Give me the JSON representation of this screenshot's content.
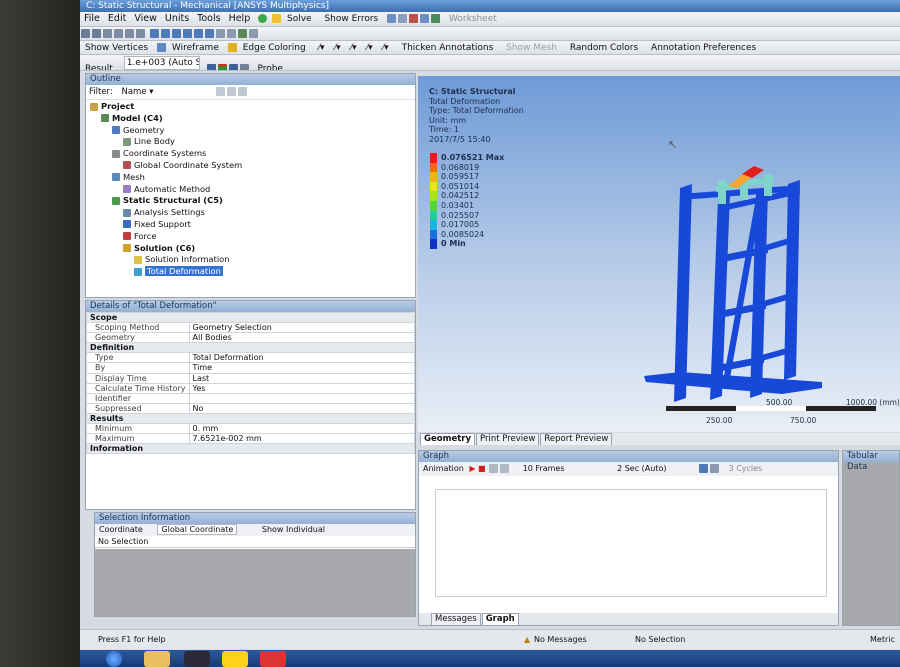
{
  "window": {
    "title": "C: Static Structural - Mechanical [ANSYS Multiphysics]"
  },
  "menu": [
    "File",
    "Edit",
    "View",
    "Units",
    "Tools",
    "Help"
  ],
  "toolbar": {
    "solve": "Solve",
    "show_errors": "Show Errors",
    "worksheet": "Worksheet",
    "show_vertices": "Show Vertices",
    "wireframe": "Wireframe",
    "edge_coloring": "Edge Coloring",
    "thicken_annotations": "Thicken Annotations",
    "show_mesh": "Show Mesh",
    "random_colors": "Random Colors",
    "annotation_preferences": "Annotation Preferences",
    "result_label": "Result",
    "result_scale": "1.e+003 (Auto Sc",
    "probe": "Probe"
  },
  "outline": {
    "title": "Outline",
    "filter_label": "Filter:",
    "filter_value": "Name",
    "items": [
      {
        "label": "Project",
        "depth": 0,
        "bold": true,
        "icon": "project-icon"
      },
      {
        "label": "Model (C4)",
        "depth": 1,
        "bold": true,
        "icon": "model-icon"
      },
      {
        "label": "Geometry",
        "depth": 2,
        "bold": false,
        "icon": "geometry-icon"
      },
      {
        "label": "Line Body",
        "depth": 3,
        "bold": false,
        "icon": "line-body-icon"
      },
      {
        "label": "Coordinate Systems",
        "depth": 2,
        "bold": false,
        "icon": "coordinate-systems-icon"
      },
      {
        "label": "Global Coordinate System",
        "depth": 3,
        "bold": false,
        "icon": "axis-icon"
      },
      {
        "label": "Mesh",
        "depth": 2,
        "bold": false,
        "icon": "mesh-icon"
      },
      {
        "label": "Automatic Method",
        "depth": 3,
        "bold": false,
        "icon": "method-icon"
      },
      {
        "label": "Static Structural (C5)",
        "depth": 2,
        "bold": true,
        "icon": "analysis-icon"
      },
      {
        "label": "Analysis Settings",
        "depth": 3,
        "bold": false,
        "icon": "settings-icon"
      },
      {
        "label": "Fixed Support",
        "depth": 3,
        "bold": false,
        "icon": "fixed-support-icon"
      },
      {
        "label": "Force",
        "depth": 3,
        "bold": false,
        "icon": "force-icon"
      },
      {
        "label": "Solution (C6)",
        "depth": 3,
        "bold": true,
        "icon": "solution-icon"
      },
      {
        "label": "Solution Information",
        "depth": 4,
        "bold": false,
        "icon": "info-icon"
      },
      {
        "label": "Total Deformation",
        "depth": 4,
        "bold": false,
        "selected": true,
        "icon": "deformation-icon"
      }
    ]
  },
  "details": {
    "title": "Details of \"Total Deformation\"",
    "groups": [
      {
        "name": "Scope",
        "rows": [
          [
            "Scoping Method",
            "Geometry Selection"
          ],
          [
            "Geometry",
            "All Bodies"
          ]
        ]
      },
      {
        "name": "Definition",
        "rows": [
          [
            "Type",
            "Total Deformation"
          ],
          [
            "By",
            "Time"
          ],
          [
            "Display Time",
            "Last"
          ],
          [
            "Calculate Time History",
            "Yes"
          ],
          [
            "Identifier",
            ""
          ],
          [
            "Suppressed",
            "No"
          ]
        ]
      },
      {
        "name": "Results",
        "rows": [
          [
            "Minimum",
            "0. mm"
          ],
          [
            "Maximum",
            "7.6521e-002 mm"
          ]
        ]
      },
      {
        "name": "Information",
        "rows": []
      }
    ]
  },
  "selection": {
    "title": "Selection Information",
    "coordinate_label": "Coordinate",
    "coordinate_value": "Global Coordinate",
    "show_individual": "Show Individual",
    "no_selection": "No Selection"
  },
  "viewport": {
    "header": [
      "C: Static Structural",
      "Total Deformation",
      "Type: Total Deformation",
      "Unit: mm",
      "Time: 1",
      "2017/7/5 15:40"
    ],
    "legend": [
      {
        "label": "0.076521 Max",
        "color": "#e0211b"
      },
      {
        "label": "0.068019",
        "color": "#f06a1c"
      },
      {
        "label": "0.059517",
        "color": "#f4b21f"
      },
      {
        "label": "0.051014",
        "color": "#e6e321"
      },
      {
        "label": "0.042512",
        "color": "#a6e02a"
      },
      {
        "label": "0.03401",
        "color": "#52d63a"
      },
      {
        "label": "0.025507",
        "color": "#1fcf9a"
      },
      {
        "label": "0.017005",
        "color": "#1ab5de"
      },
      {
        "label": "0.0085024",
        "color": "#1a6fe0"
      },
      {
        "label": "0 Min",
        "color": "#1030c8"
      }
    ],
    "scale_top": [
      "500.00",
      "1000.00 (mm)"
    ],
    "scale_bottom": [
      "250.00",
      "750.00"
    ],
    "tabs": [
      "Geometry",
      "Print Preview",
      "Report Preview"
    ],
    "structure_color": "#1848d8",
    "top_color": "#7fd4c9"
  },
  "graph": {
    "title": "Graph",
    "animation_label": "Animation",
    "frames": "10 Frames",
    "duration": "2 Sec (Auto)",
    "cycles": "3 Cycles",
    "tabs": [
      "Messages",
      "Graph"
    ]
  },
  "tabular": {
    "title": "Tabular Data"
  },
  "status": {
    "help": "Press F1 for Help",
    "messages": "No Messages",
    "selection": "No Selection",
    "units": "Metric"
  }
}
